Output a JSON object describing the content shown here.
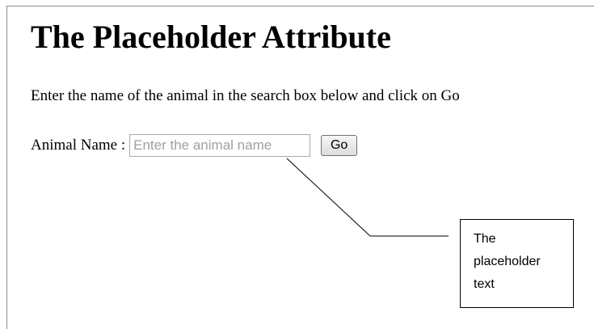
{
  "page": {
    "title": "The Placeholder Attribute",
    "instructions": "Enter the name of the animal in the search box below and click on Go"
  },
  "search": {
    "label": "Animal Name :",
    "value": "",
    "placeholder": "Enter the animal name",
    "go_label": "Go"
  },
  "annotation": {
    "text": "The placeholder text"
  },
  "colors": {
    "placeholder_text": "#a0a0a0",
    "input_border": "#a9a9a9",
    "frame_border": "#8c8c8c"
  }
}
